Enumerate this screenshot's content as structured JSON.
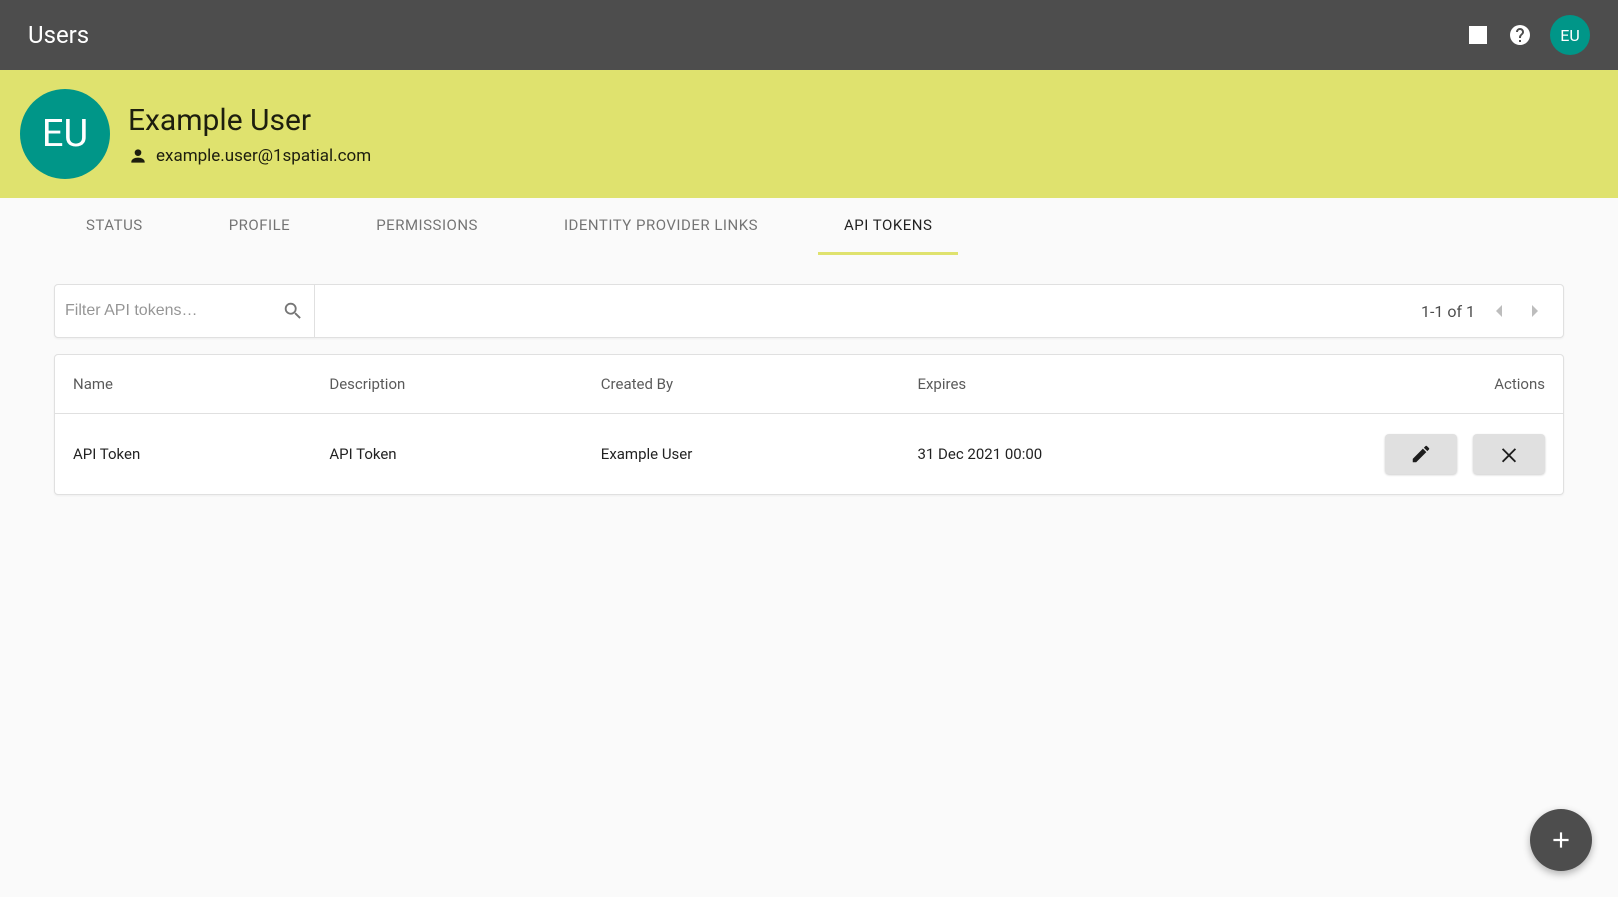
{
  "appbar": {
    "title": "Users",
    "avatar_initials": "EU"
  },
  "banner": {
    "avatar_initials": "EU",
    "name": "Example User",
    "email": "example.user@1spatial.com"
  },
  "tabs": [
    {
      "label": "STATUS",
      "active": false
    },
    {
      "label": "PROFILE",
      "active": false
    },
    {
      "label": "PERMISSIONS",
      "active": false
    },
    {
      "label": "IDENTITY PROVIDER LINKS",
      "active": false
    },
    {
      "label": "API TOKENS",
      "active": true
    }
  ],
  "filter": {
    "placeholder": "Filter API tokens…",
    "value": ""
  },
  "pagination": {
    "range_label": "1-1 of 1"
  },
  "table": {
    "headers": {
      "name": "Name",
      "description": "Description",
      "created_by": "Created By",
      "expires": "Expires",
      "actions": "Actions"
    },
    "rows": [
      {
        "name": "API Token",
        "description": "API Token",
        "created_by": "Example User",
        "expires": "31 Dec 2021 00:00"
      }
    ]
  }
}
